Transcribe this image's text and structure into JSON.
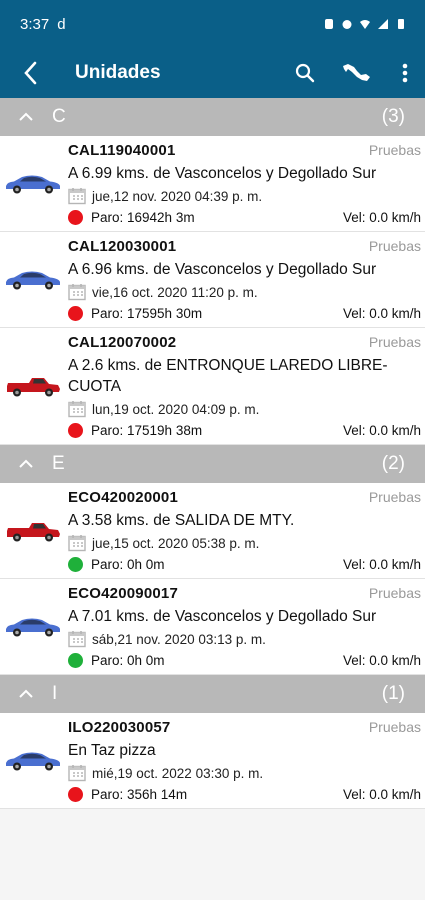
{
  "status": {
    "time": "3:37",
    "carrier_icon": "d"
  },
  "appbar": {
    "title": "Unidades"
  },
  "colors": {
    "primary": "#0a5f88",
    "group_header": "#b8b8b8",
    "red": "#e8141b",
    "green": "#1fb03a",
    "car_blue": "#4a6fd0",
    "car_red": "#c5161d"
  },
  "groups": [
    {
      "letter": "C",
      "count": "(3)",
      "items": [
        {
          "unit": "CAL119040001",
          "tag": "Pruebas",
          "address": "A 6.99 kms. de Vasconcelos y Degollado Sur",
          "date": "jue,12 nov. 2020 04:39 p. m.",
          "paro": "Paro: 16942h 3m",
          "vel": "Vel: 0.0 km/h",
          "status": "red",
          "vehicle": "blue-sedan-icon"
        },
        {
          "unit": "CAL120030001",
          "tag": "Pruebas",
          "address": "A 6.96 kms. de Vasconcelos y Degollado Sur",
          "date": "vie,16 oct. 2020 11:20 p. m.",
          "paro": "Paro: 17595h 30m",
          "vel": "Vel: 0.0 km/h",
          "status": "red",
          "vehicle": "blue-sedan-icon"
        },
        {
          "unit": "CAL120070002",
          "tag": "Pruebas",
          "address": "A 2.6 kms. de ENTRONQUE LAREDO LIBRE-CUOTA",
          "date": "lun,19 oct. 2020 04:09 p. m.",
          "paro": "Paro: 17519h 38m",
          "vel": "Vel: 0.0 km/h",
          "status": "red",
          "vehicle": "red-pickup-icon"
        }
      ]
    },
    {
      "letter": "E",
      "count": "(2)",
      "items": [
        {
          "unit": "ECO420020001",
          "tag": "Pruebas",
          "address": "A 3.58 kms. de SALIDA DE MTY.",
          "date": "jue,15 oct. 2020 05:38 p. m.",
          "paro": "Paro: 0h 0m",
          "vel": "Vel: 0.0 km/h",
          "status": "green",
          "vehicle": "red-pickup-icon"
        },
        {
          "unit": "ECO420090017",
          "tag": "Pruebas",
          "address": "A 7.01 kms. de Vasconcelos y Degollado Sur",
          "date": "sáb,21 nov. 2020 03:13 p. m.",
          "paro": "Paro: 0h 0m",
          "vel": "Vel: 0.0 km/h",
          "status": "green",
          "vehicle": "blue-sedan-icon"
        }
      ]
    },
    {
      "letter": "I",
      "count": "(1)",
      "items": [
        {
          "unit": "ILO220030057",
          "tag": "Pruebas",
          "address": "En Taz pizza",
          "date": "mié,19 oct. 2022 03:30 p. m.",
          "paro": "Paro: 356h 14m",
          "vel": "Vel: 0.0 km/h",
          "status": "red",
          "vehicle": "blue-sedan-icon"
        }
      ]
    }
  ]
}
